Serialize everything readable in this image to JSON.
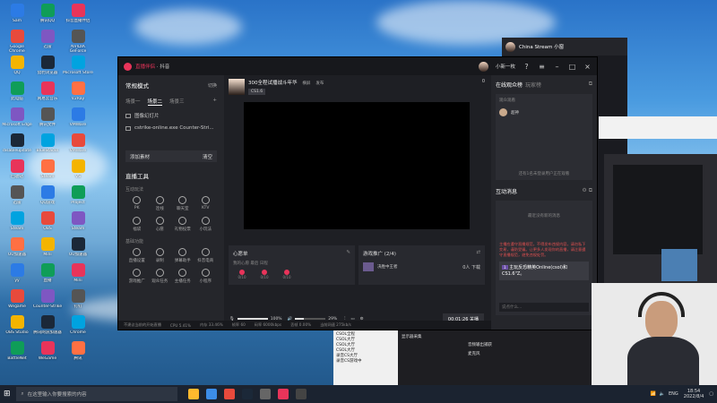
{
  "desktop": {
    "icons_col1": [
      "Sam",
      "Google Chrome",
      "QQ",
      "此电脑",
      "Microsoft Edge",
      "disableupdate",
      "回收站",
      "迅雷",
      "Steam",
      "UU加速器",
      "yy",
      "Wegame",
      "OBS Studio",
      "BattleNet"
    ],
    "icons_col2": [
      "腾讯QQ",
      "迅雷",
      "猎豹浏览器",
      "网易云音乐",
      "腾讯文件",
      "BlueStacks",
      "Steam",
      "QQ游戏",
      "OBS",
      "Mini",
      "直播",
      "Counter-Strike",
      "腾讯网游加速器",
      "WeGame"
    ],
    "icons_col3": [
      "抖音直播伴侣",
      "NVIDIA GeForce",
      "Microsoft Store",
      "V2Ray",
      "VMWare",
      "VMWare",
      "VS",
      "Project",
      "Steam",
      "UU加速器",
      "Mini",
      "钉钉",
      "Chrome",
      "腾讯"
    ]
  },
  "taskbar": {
    "search_placeholder": "在这里输入你要搜索的内容",
    "ime": "ENG",
    "time": "18:54",
    "date": "2022/8/4"
  },
  "window": {
    "title_prefix": "直播伴侣",
    "title_rest": " · 抖音",
    "username": "小新一枚"
  },
  "left": {
    "mode_title": "常规模式",
    "mode_switch": "切换",
    "scene_tabs": [
      "场景一",
      "场景二",
      "场景三"
    ],
    "active_scene": 1,
    "sources": [
      "图像幻灯片",
      "cstrike-online.exe Counter-Stri..."
    ],
    "add_material": "添加素材",
    "clear": "清空",
    "tools_title": "直播工具",
    "group_interact": "互动玩法",
    "interact_tools": [
      "PK",
      "连线",
      "聊天室",
      "KTV",
      "福袋",
      "心愿",
      "礼物投票",
      "小玩法"
    ],
    "group_basic": "基础功能",
    "basic_tools": [
      "直播设置",
      "录制",
      "弹幕助手",
      "抖音电商",
      "游戏推广",
      "观众任务",
      "主播任务",
      "小程序"
    ]
  },
  "center": {
    "stream_title": "300全程试播战斗年华",
    "stream_tag": "CS1.6",
    "header_btns": [
      "横屏",
      "发布"
    ],
    "viewer_count": "0",
    "wish_title": "心愿单",
    "wish_sub": "我的心愿 最后 日程",
    "gifts": [
      "0/10",
      "0/10",
      "0/10"
    ],
    "game_promo_title": "游戏推广 (2/4)",
    "game_name": "决胜中王者",
    "game_count": "0人 下载",
    "vol1": "100%",
    "vol2": "29%",
    "live_time": "00:01:26",
    "live_btn": "关播",
    "status": [
      "不建议当前的开始直播",
      "CPU 5.41%",
      "内存 33.46%",
      "帧率 60",
      "码率 6000kbps",
      "丢帧 0.00%",
      "当前网速 275kb/s"
    ]
  },
  "right": {
    "audience_title": "在线观众榜",
    "audience_sub": "玩家榜",
    "audience_tab": "观众观看",
    "audience_user": "超神",
    "audience_empty": "还有1名未登录用户正在观看",
    "msg_title": "互动消息",
    "msg_hint": "最近没有新的消息",
    "notice": "主播应遵守直播规范，不得发布违规内容，请勿私下交易，谨防受骗。让更多人发现你的直播，请注意遵守直播规范，避免违规处罚。",
    "bubble_badge": "1",
    "bubble_text": "主玩反恐精英Online(csol)和CS1.6\"Z。",
    "input_placeholder": "说点什么..."
  },
  "bgwin": {
    "chat_title": "China Stream 小窗",
    "obs_sources": [
      "CSOL全程",
      "CSOL大厅",
      "CSOL大厅",
      "CSOL大厅",
      "录音CS大厅",
      "录音CS游戏中"
    ],
    "obs_mix1": "显示器采集",
    "obs_mix2": "音频输出捕获",
    "obs_mix3": "麦克风",
    "obs_status": "CPU: 6.7%, 60.00 fps"
  },
  "colors": {
    "accent": "#e8345a",
    "panel": "#25262b",
    "dark": "#1e1f24"
  }
}
